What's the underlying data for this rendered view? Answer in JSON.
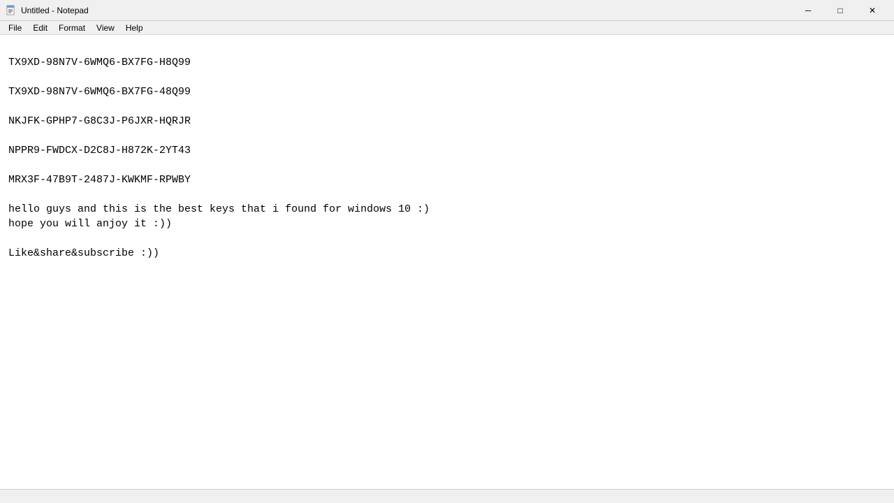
{
  "window": {
    "title": "Untitled - Notepad",
    "icon": "notepad-icon"
  },
  "titlebar": {
    "minimize_label": "─",
    "maximize_label": "□",
    "close_label": "✕"
  },
  "menubar": {
    "items": [
      "File",
      "Edit",
      "Format",
      "View",
      "Help"
    ]
  },
  "content": {
    "lines": [
      "TX9XD-98N7V-6WMQ6-BX7FG-H8Q99",
      "",
      "TX9XD-98N7V-6WMQ6-BX7FG-48Q99",
      "",
      "NKJFK-GPHP7-G8C3J-P6JXR-HQRJR",
      "",
      "NPPR9-FWDCX-D2C8J-H872K-2YT43",
      "",
      "MRX3F-47B9T-2487J-KWKMF-RPWBY",
      "",
      "hello guys and this is the best keys that i found for windows 10 :)",
      "hope you will anjoy it :))",
      "",
      "Like&share&subscribe :))",
      "",
      "",
      ""
    ]
  }
}
